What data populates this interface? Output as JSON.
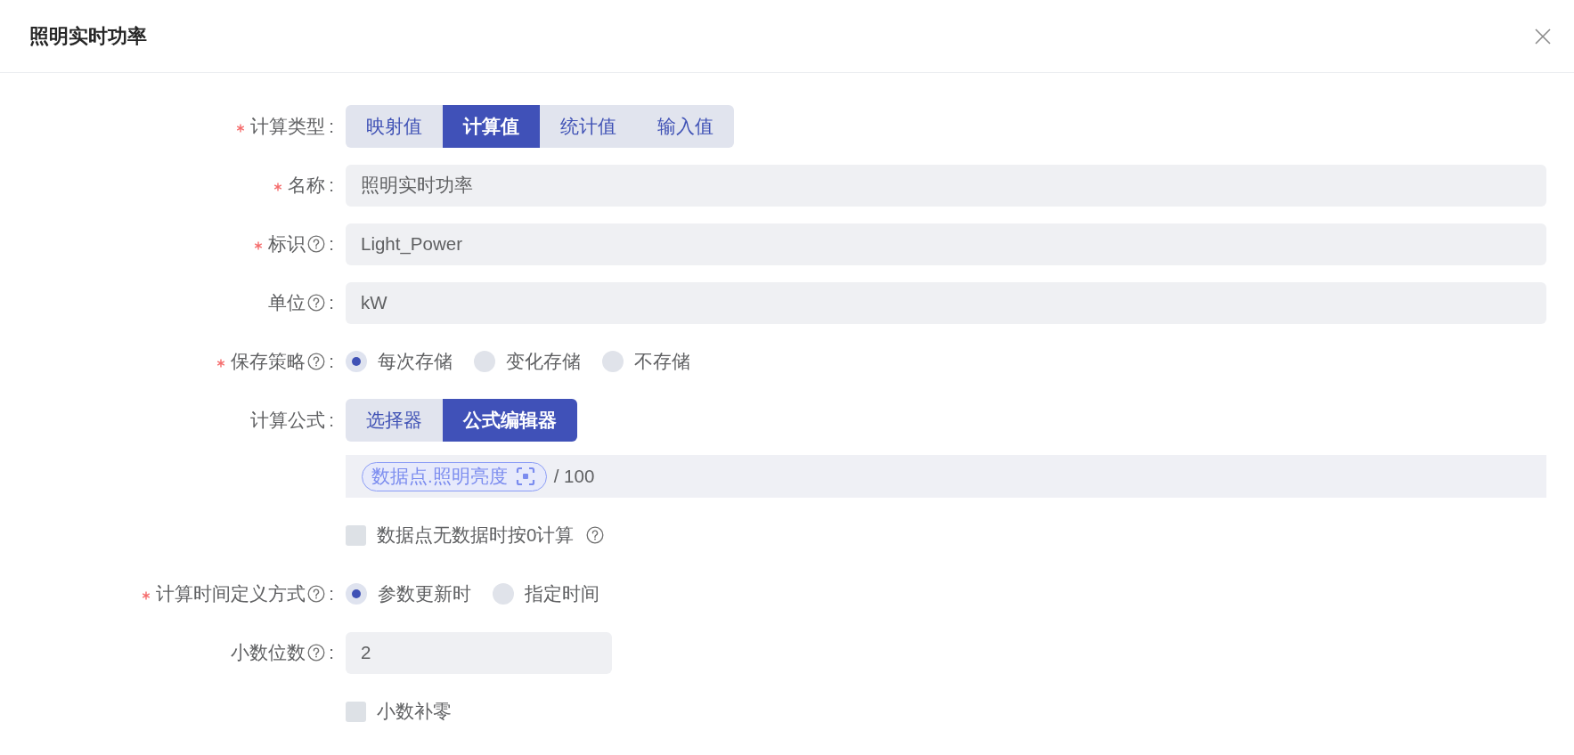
{
  "dialog": {
    "title": "照明实时功率"
  },
  "form": {
    "rows": [
      {
        "kind": "segmented",
        "label": "计算类型",
        "colon": ":",
        "required": true,
        "help": false,
        "options": [
          {
            "label": "映射值",
            "selected": false
          },
          {
            "label": "计算值",
            "selected": true
          },
          {
            "label": "统计值",
            "selected": false
          },
          {
            "label": "输入值",
            "selected": false
          }
        ]
      },
      {
        "kind": "input",
        "label": "名称",
        "colon": ":",
        "required": true,
        "help": false,
        "value": "照明实时功率"
      },
      {
        "kind": "input",
        "label": "标识",
        "colon": ":",
        "required": true,
        "help": true,
        "value": "Light_Power"
      },
      {
        "kind": "input",
        "label": "单位",
        "colon": ":",
        "required": false,
        "help": true,
        "value": "kW"
      },
      {
        "kind": "radio",
        "label": "保存策略",
        "colon": ":",
        "required": true,
        "help": true,
        "options": [
          {
            "label": "每次存储",
            "selected": true
          },
          {
            "label": "变化存储",
            "selected": false
          },
          {
            "label": "不存储",
            "selected": false
          }
        ]
      },
      {
        "kind": "segmented",
        "label": "计算公式",
        "colon": ":",
        "required": false,
        "help": false,
        "options": [
          {
            "label": "选择器",
            "selected": false
          },
          {
            "label": "公式编辑器",
            "selected": true
          }
        ]
      },
      {
        "kind": "formula",
        "tokens": [
          {
            "kind": "variable",
            "text": "数据点.照明亮度"
          },
          {
            "kind": "text",
            "text": "/ 100"
          }
        ]
      },
      {
        "kind": "checkbox",
        "text": "数据点无数据时按0计算",
        "checked": false,
        "help": true
      },
      {
        "kind": "radio",
        "label": "计算时间定义方式",
        "colon": ":",
        "required": true,
        "help": true,
        "options": [
          {
            "label": "参数更新时",
            "selected": true
          },
          {
            "label": "指定时间",
            "selected": false
          }
        ]
      },
      {
        "kind": "number",
        "label": "小数位数",
        "colon": ":",
        "required": false,
        "help": true,
        "value": "2"
      },
      {
        "kind": "checkbox",
        "text": "小数补零",
        "checked": false,
        "help": false
      }
    ]
  }
}
